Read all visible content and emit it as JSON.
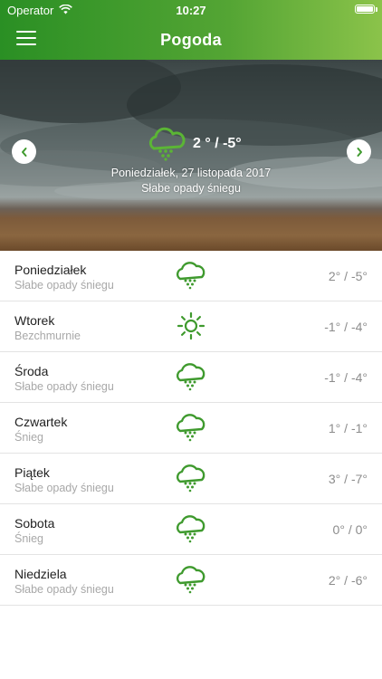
{
  "status_bar": {
    "operator": "Operator",
    "time": "10:27"
  },
  "header": {
    "title": "Pogoda"
  },
  "current": {
    "temperature": "2 ° / -5°",
    "date": "Poniedziałek, 27 listopada 2017",
    "description": "Słabe opady śniegu",
    "icon": "snow-cloud-icon"
  },
  "forecast": [
    {
      "day": "Poniedziałek",
      "condition": "Słabe opady śniegu",
      "temps": "2° / -5°",
      "icon": "snow-cloud-icon"
    },
    {
      "day": "Wtorek",
      "condition": "Bezchmurnie",
      "temps": "-1° / -4°",
      "icon": "sun-icon"
    },
    {
      "day": "Środa",
      "condition": "Słabe opady śniegu",
      "temps": "-1° / -4°",
      "icon": "snow-cloud-icon"
    },
    {
      "day": "Czwartek",
      "condition": "Śnieg",
      "temps": "1° / -1°",
      "icon": "snow-cloud-icon"
    },
    {
      "day": "Piątek",
      "condition": "Słabe opady śniegu",
      "temps": "3° / -7°",
      "icon": "snow-cloud-icon"
    },
    {
      "day": "Sobota",
      "condition": "Śnieg",
      "temps": "0° / 0°",
      "icon": "snow-cloud-icon"
    },
    {
      "day": "Niedziela",
      "condition": "Słabe opady śniegu",
      "temps": "2° / -6°",
      "icon": "snow-cloud-icon"
    }
  ],
  "colors": {
    "accent": "#3f9a2e",
    "header_start": "#2a8f24",
    "header_end": "#8bc34a",
    "secondary_text": "#a8a8a8"
  }
}
